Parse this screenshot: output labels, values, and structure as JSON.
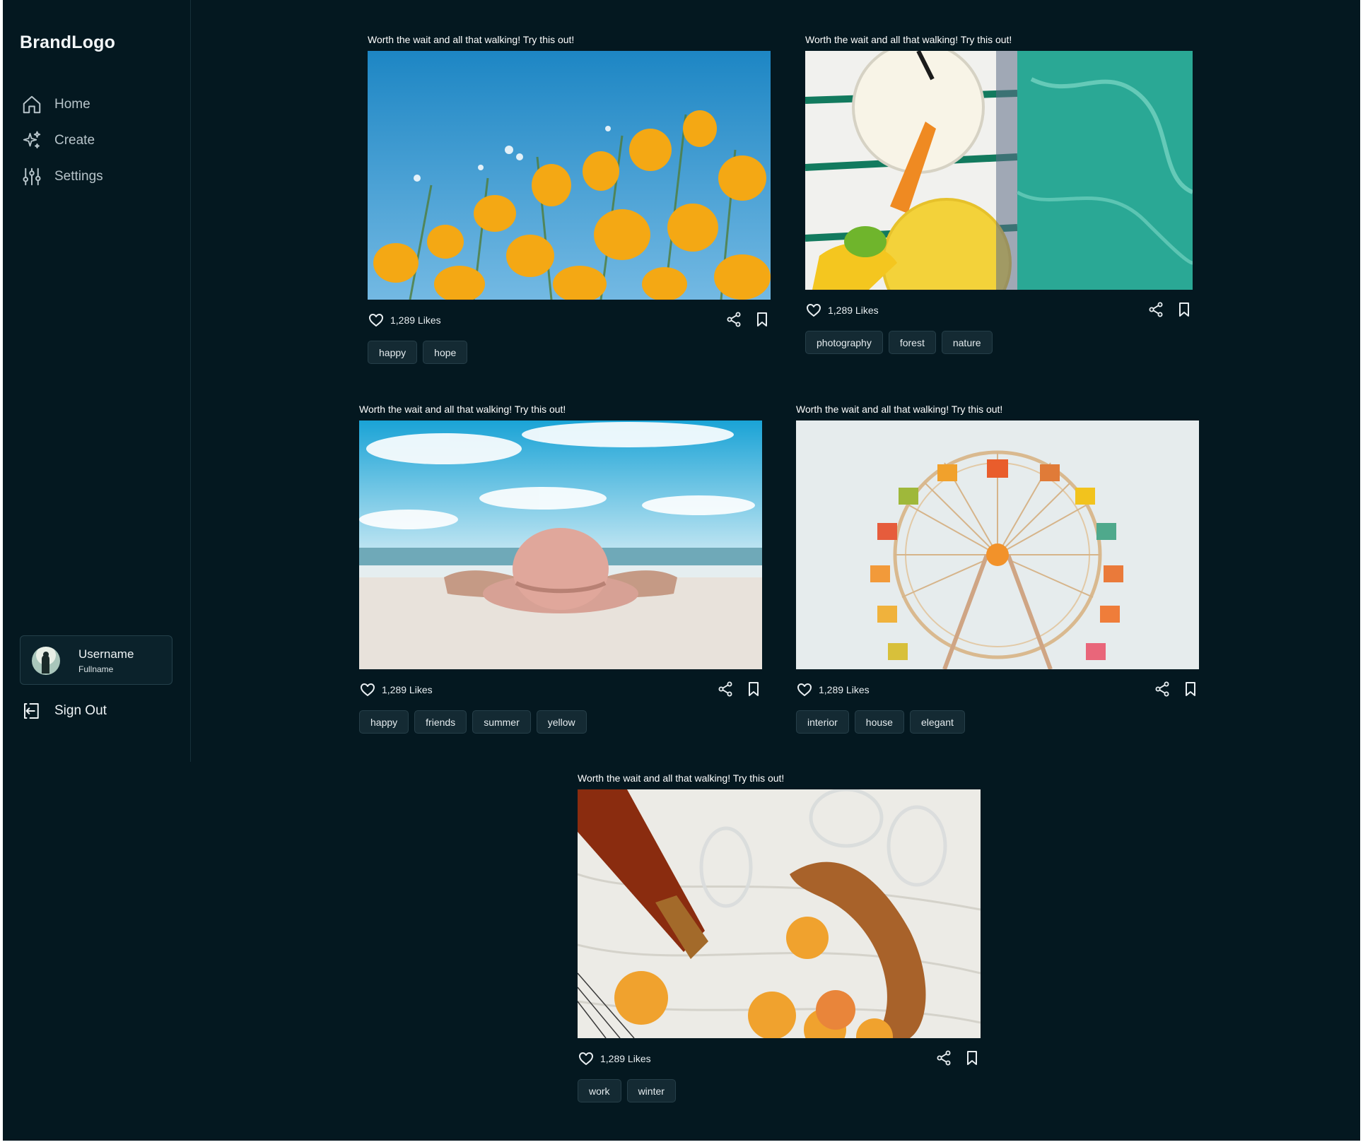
{
  "brand": "BrandLogo",
  "nav": [
    {
      "label": "Home",
      "icon": "home-icon"
    },
    {
      "label": "Create",
      "icon": "sparkle-icon"
    },
    {
      "label": "Settings",
      "icon": "sliders-icon"
    }
  ],
  "user": {
    "username": "Username",
    "fullname": "Fullname"
  },
  "signout_label": "Sign Out",
  "posts": [
    {
      "caption": "Worth the wait and all that walking! Try this out!",
      "likes": "1,289 Likes",
      "image": "yellow-poppies-photo",
      "tags": [
        "happy",
        "hope"
      ]
    },
    {
      "caption": "Worth the wait and all that walking! Try this out!",
      "likes": "1,289 Likes",
      "image": "poolside-drinks-photo",
      "tags": [
        "photography",
        "forest",
        "nature"
      ]
    },
    {
      "caption": "Worth the wait and all that walking! Try this out!",
      "likes": "1,289 Likes",
      "image": "beach-sunhat-photo",
      "tags": [
        "happy",
        "friends",
        "summer",
        "yellow"
      ]
    },
    {
      "caption": "Worth the wait and all that walking! Try this out!",
      "likes": "1,289 Likes",
      "image": "ferris-wheel-photo",
      "tags": [
        "interior",
        "house",
        "elegant"
      ]
    },
    {
      "caption": "Worth the wait and all that walking! Try this out!",
      "likes": "1,289 Likes",
      "image": "picnic-apricots-photo",
      "tags": [
        "work",
        "winter"
      ]
    }
  ],
  "colors": {
    "background": "#041820",
    "tag_bg": "#142a33",
    "text": "#e7edf0"
  }
}
